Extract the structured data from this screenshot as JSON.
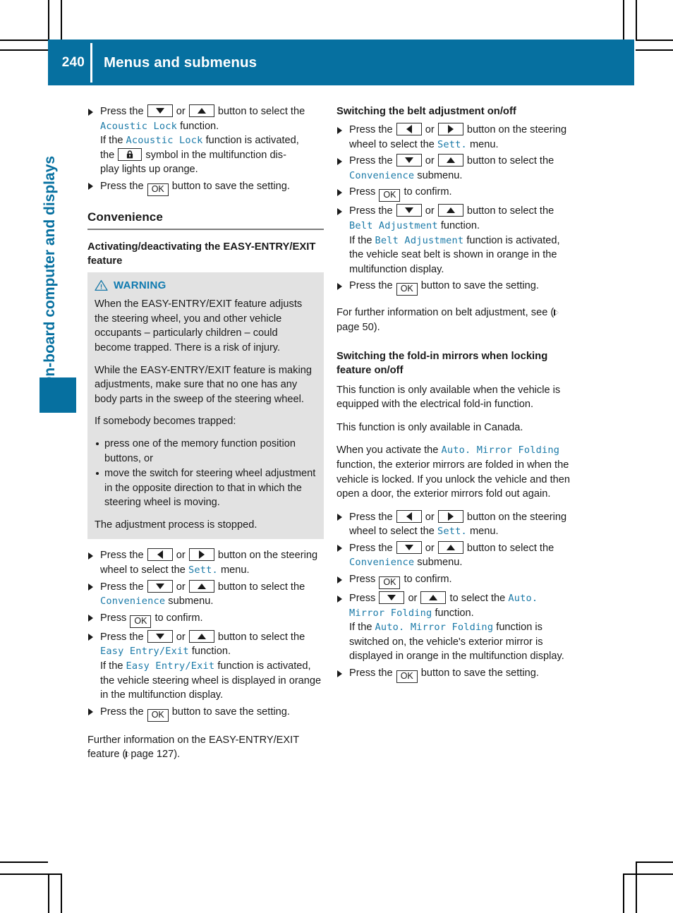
{
  "header": {
    "page_number": "240",
    "title": "Menus and submenus",
    "accent_color": "#0670a0"
  },
  "chapter_tab": {
    "label": "On-board computer and displays",
    "color": "#0670a0"
  },
  "keys": {
    "down": "down-arrow",
    "up": "up-arrow",
    "left": "left-arrow",
    "right": "right-arrow",
    "ok": "OK",
    "lock": "padlock-symbol"
  },
  "left_column": {
    "step_acoustic_lock": {
      "t1": "Press the",
      "t2": "or",
      "t3": "button to select the",
      "fn": "Acoustic Lock",
      "t4": "function.",
      "t5": "If the",
      "t6": "function is activated,",
      "t7": "the",
      "t8": "symbol in the multifunction dis-",
      "t9": "play lights up orange."
    },
    "step_save_1": {
      "t1": "Press the",
      "t2": "button to save the setting."
    },
    "section_heading": "Convenience",
    "subheading": "Activating/deactivating the EASY-ENTRY/EXIT feature",
    "warning": {
      "label": "WARNING",
      "icon": "warning-triangle-icon",
      "p1": "When the EASY-ENTRY/EXIT feature adjusts the steering wheel, you and other vehicle occupants – particularly children – could become trapped. There is a risk of injury.",
      "p2": "While the EASY-ENTRY/EXIT feature is making adjustments, make sure that no one has any body parts in the sweep of the steering wheel.",
      "p3": "If somebody becomes trapped:",
      "bullets": [
        "press one of the memory function position buttons, or",
        "move the switch for steering wheel adjustment in the opposite direction to that in which the steering wheel is moving."
      ],
      "p4": "The adjustment process is stopped."
    },
    "step_sett": {
      "t1": "Press the",
      "t2": "or",
      "t3": "button on the steering wheel to select the",
      "menu": "Sett.",
      "t4": "menu."
    },
    "step_convenience": {
      "t1": "Press the",
      "t2": "or",
      "t3": "button to select the",
      "submenu": "Convenience",
      "t4": "submenu."
    },
    "step_confirm": {
      "t1": "Press",
      "t2": "to confirm."
    },
    "step_easy_entry": {
      "t1": "Press the",
      "t2": "or",
      "t3": "button to select the",
      "fn": "Easy Entry/Exit",
      "t4": "function.",
      "t5": "If the",
      "t6": "function is activated, the vehicle steering wheel is displayed in orange in the multifunction display."
    },
    "step_save_2": {
      "t1": "Press the",
      "t2": "button to save the setting."
    },
    "footer_note": {
      "t1": "Further information on the EASY-ENTRY/EXIT feature (",
      "page_label": "page",
      "page_ref": "127",
      "t2": ")."
    }
  },
  "right_column": {
    "belt_section": {
      "heading": "Switching the belt adjustment on/off",
      "step_sett": {
        "t1": "Press the",
        "t2": "or",
        "t3": "button on the steering wheel to select the",
        "menu": "Sett.",
        "t4": "menu."
      },
      "step_convenience": {
        "t1": "Press the",
        "t2": "or",
        "t3": "button to select the",
        "submenu": "Convenience",
        "t4": "submenu."
      },
      "step_confirm": {
        "t1": "Press",
        "t2": "to confirm."
      },
      "step_belt": {
        "t1": "Press the",
        "t2": "or",
        "t3": "button to select the",
        "fn": "Belt Adjustment",
        "t4": "function.",
        "t5": "If the",
        "t6": "function is activated, the vehicle seat belt is shown in orange in the multifunction display."
      },
      "step_save": {
        "t1": "Press the",
        "t2": "button to save the setting."
      },
      "footer_note": {
        "t1": "For further information on belt adjustment, see (",
        "page_label": "page",
        "page_ref": "50",
        "t2": ")."
      }
    },
    "mirror_section": {
      "heading": "Switching the fold-in mirrors when locking feature on/off",
      "p1": "This function is only available when the vehicle is equipped with the electrical fold-in function.",
      "p2": "This function is only available in Canada.",
      "p3_a": "When you activate the",
      "p3_fn": "Auto. Mirror Folding",
      "p3_b": "function, the exterior mirrors are folded in when the vehicle is locked. If you unlock the vehicle and then open a door, the exterior mirrors fold out again.",
      "step_sett": {
        "t1": "Press the",
        "t2": "or",
        "t3": "button on the steering wheel to select the",
        "menu": "Sett.",
        "t4": "menu."
      },
      "step_convenience": {
        "t1": "Press the",
        "t2": "or",
        "t3": "button to select the",
        "submenu": "Convenience",
        "t4": "submenu."
      },
      "step_confirm": {
        "t1": "Press",
        "t2": "to confirm."
      },
      "step_mirror": {
        "t1": "Press",
        "t2": "or",
        "t3": "to select the",
        "fn": "Auto. Mirror Folding",
        "t4": "function.",
        "t5": "If the",
        "t6": "function is switched on, the vehicle's exterior mirror is displayed in orange in the multifunction display."
      },
      "step_save": {
        "t1": "Press the",
        "t2": "button to save the setting."
      }
    }
  }
}
